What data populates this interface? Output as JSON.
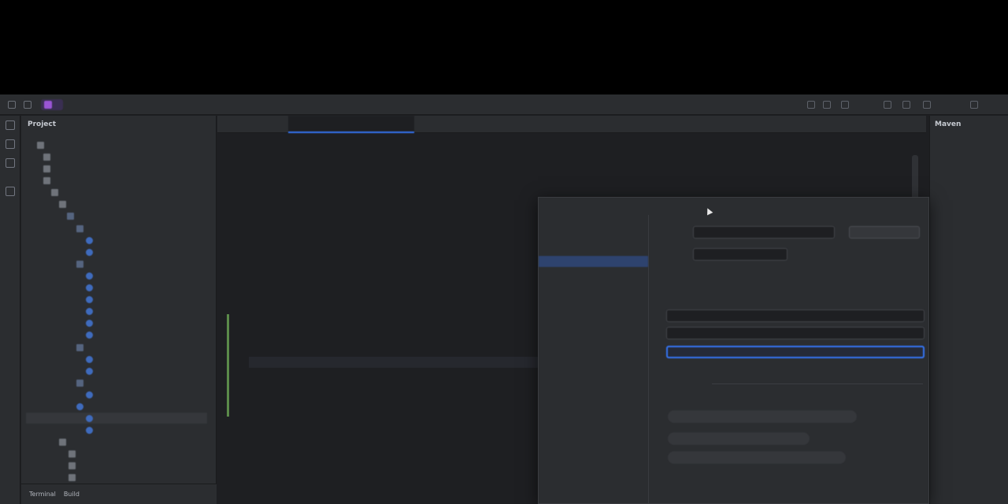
{
  "app": {
    "project_badge": "",
    "branch": "",
    "run_config": ""
  },
  "project_panel": {
    "title": "Project",
    "bottom_tabs": [
      "Terminal",
      "Build"
    ]
  },
  "editor": {
    "tabs": [
      {
        "label": "",
        "state": "normal"
      },
      {
        "label": "",
        "state": "active"
      },
      {
        "label": "",
        "state": "normal"
      },
      {
        "label": "",
        "state": "orange"
      },
      {
        "label": "",
        "state": "green"
      },
      {
        "label": "",
        "state": "normal"
      }
    ]
  },
  "right_panel": {
    "title": "Maven"
  },
  "colors": {
    "background": "#1e1f22",
    "panel": "#2b2d30",
    "accent": "#3574f0",
    "selection": "#2e436e",
    "project_badge": "#9a55d6"
  }
}
